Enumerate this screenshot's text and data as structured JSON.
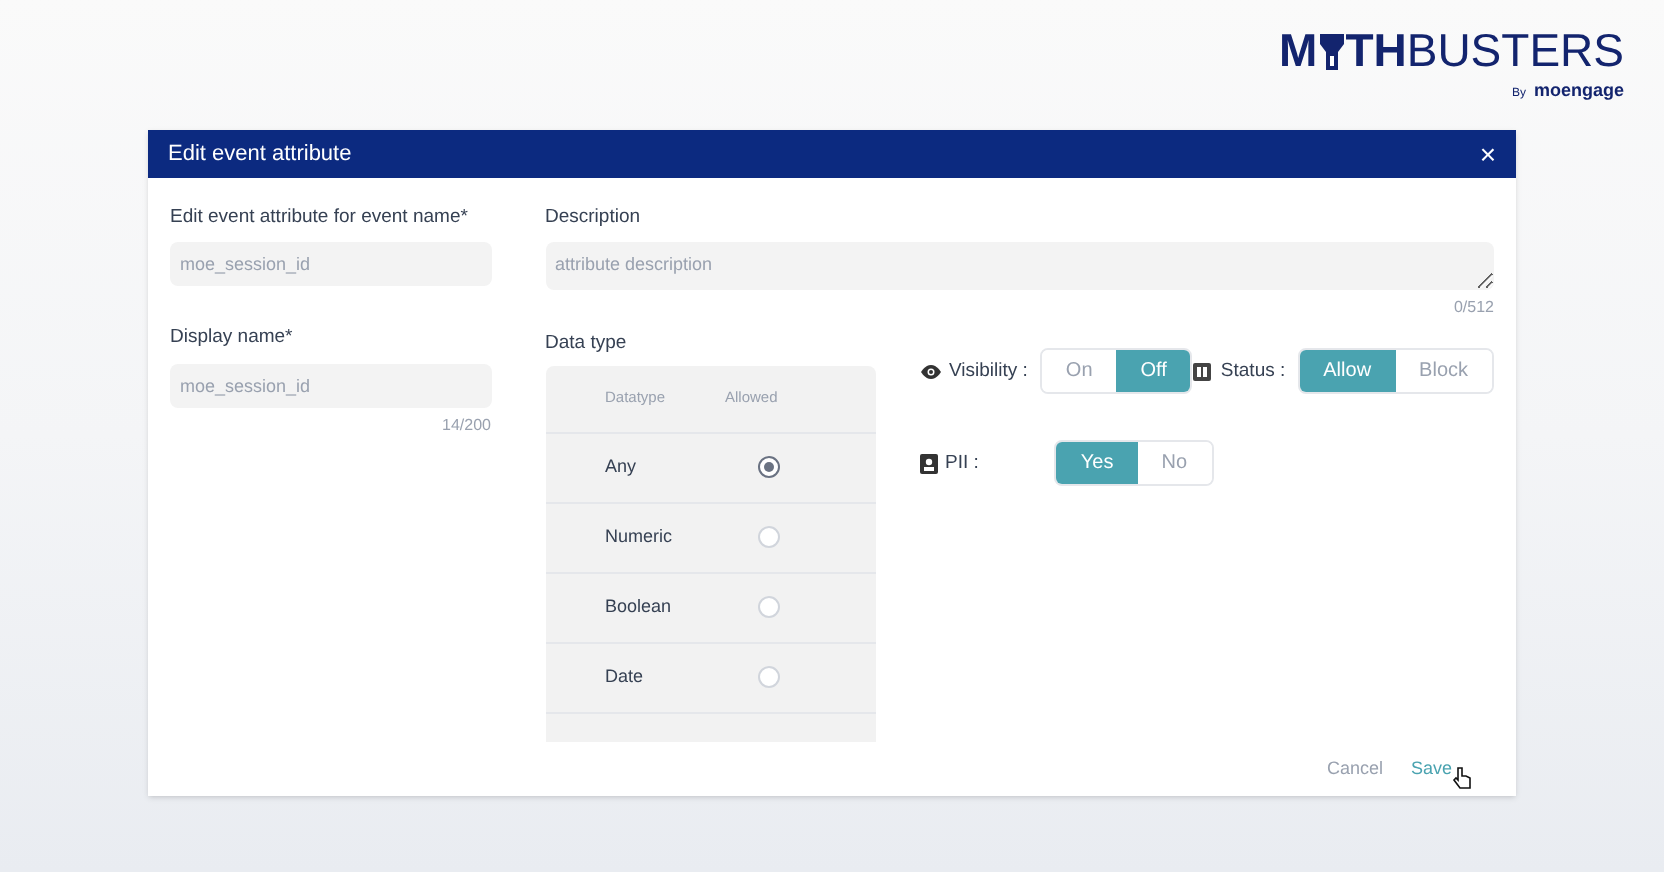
{
  "logo": {
    "prefix": "M",
    "bold": "TH",
    "rest": "BUSTERS",
    "by": "By",
    "brand": "moengage"
  },
  "dialog": {
    "title": "Edit event attribute",
    "close": "×"
  },
  "event_name": {
    "label": "Edit event attribute for event name*",
    "value": "moe_session_id"
  },
  "display_name": {
    "label": "Display name*",
    "value": "moe_session_id",
    "counter": "14/200"
  },
  "description": {
    "label": "Description",
    "placeholder": "attribute description",
    "counter": "0/512"
  },
  "data_type": {
    "label": "Data type",
    "columns": [
      "Datatype",
      "Allowed"
    ],
    "rows": [
      {
        "name": "Any",
        "selected": true
      },
      {
        "name": "Numeric",
        "selected": false
      },
      {
        "name": "Boolean",
        "selected": false
      },
      {
        "name": "Date",
        "selected": false
      }
    ]
  },
  "visibility": {
    "label": "Visibility :",
    "options": [
      {
        "label": "On",
        "selected": false
      },
      {
        "label": "Off",
        "selected": true
      }
    ]
  },
  "status": {
    "label": "Status :",
    "options": [
      {
        "label": "Allow",
        "selected": true
      },
      {
        "label": "Block",
        "selected": false
      }
    ]
  },
  "pii": {
    "label": "PII :",
    "options": [
      {
        "label": "Yes",
        "selected": true
      },
      {
        "label": "No",
        "selected": false
      }
    ]
  },
  "footer": {
    "cancel": "Cancel",
    "save": "Save"
  }
}
